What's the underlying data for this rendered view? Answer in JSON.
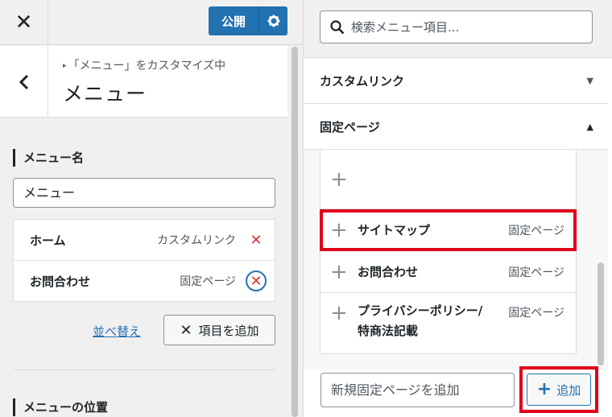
{
  "left_panel": {
    "close_glyph": "✕",
    "publish_label": "公開",
    "breadcrumb": "「メニュー」をカスタマイズ中",
    "title": "メニュー",
    "menu_name_label": "メニュー名",
    "menu_name_value": "メニュー",
    "menu_items": [
      {
        "title": "ホーム",
        "type": "カスタムリンク"
      },
      {
        "title": "お問合わせ",
        "type": "固定ページ"
      }
    ],
    "reorder_label": "並べ替え",
    "add_items_label": "項目を追加",
    "menu_location_label": "メニューの位置"
  },
  "right_panel": {
    "search_placeholder": "検索メニュー項目...",
    "sections": [
      {
        "title": "カスタムリンク",
        "expanded": false
      },
      {
        "title": "固定ページ",
        "expanded": true
      }
    ],
    "pages": [
      {
        "title": "",
        "type": ""
      },
      {
        "title": "サイトマップ",
        "type": "固定ページ"
      },
      {
        "title": "お問合わせ",
        "type": "固定ページ"
      },
      {
        "title": "プライバシーポリシー/特商法記載",
        "type": "固定ページ"
      }
    ],
    "new_page_placeholder": "新規固定ページを追加",
    "add_label": "追加"
  },
  "colors": {
    "accent": "#2271b1",
    "delete": "#d63638",
    "highlight": "#e0001b"
  }
}
